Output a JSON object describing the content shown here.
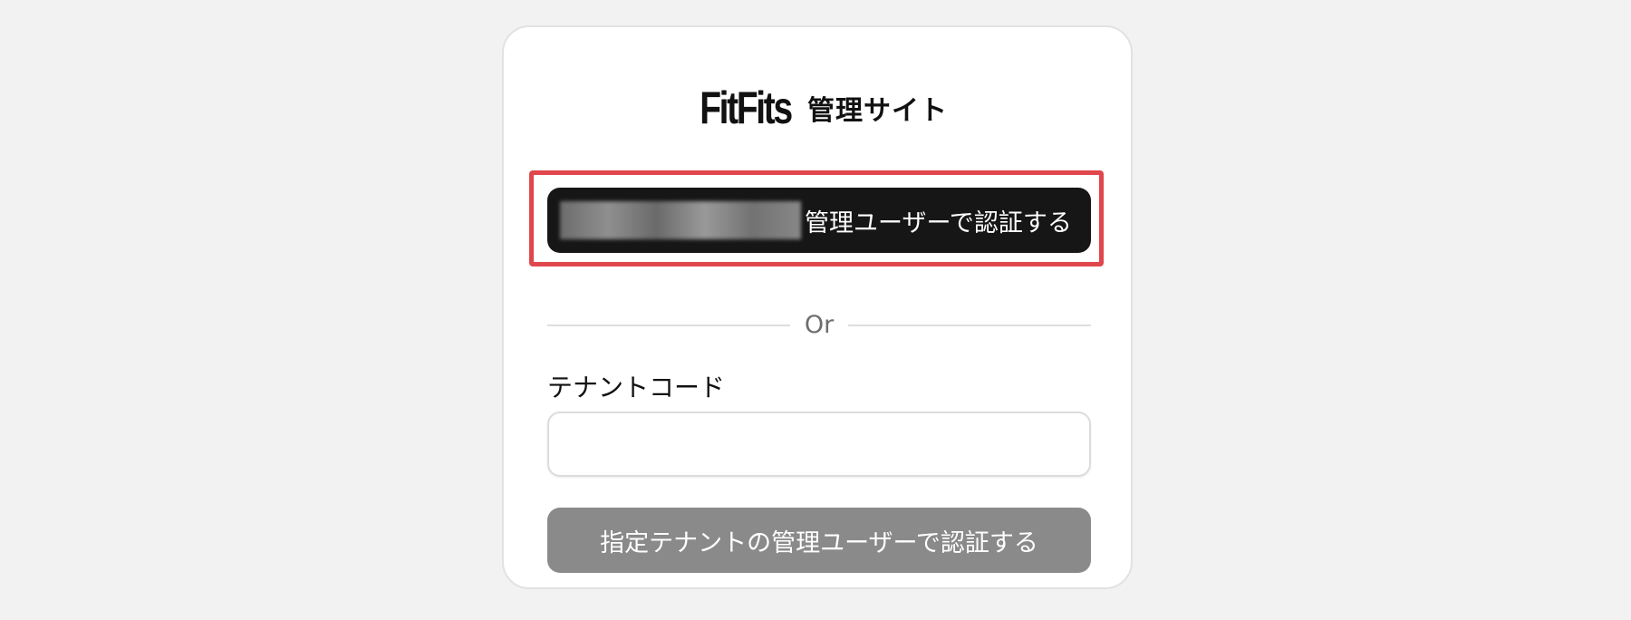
{
  "brand": {
    "logo_text": "FitFits",
    "title": "管理サイト"
  },
  "admin_auth": {
    "label": "管理ユーザーで認証する"
  },
  "divider": {
    "text": "Or"
  },
  "tenant": {
    "field_label": "テナントコード",
    "input_value": "",
    "input_placeholder": "",
    "submit_label": "指定テナントの管理ユーザーで認証する"
  },
  "colors": {
    "page_background": "#f2f2f2",
    "primary_button": "#161616",
    "disabled_button": "#8a8a8a",
    "highlight": "#e0474c"
  }
}
